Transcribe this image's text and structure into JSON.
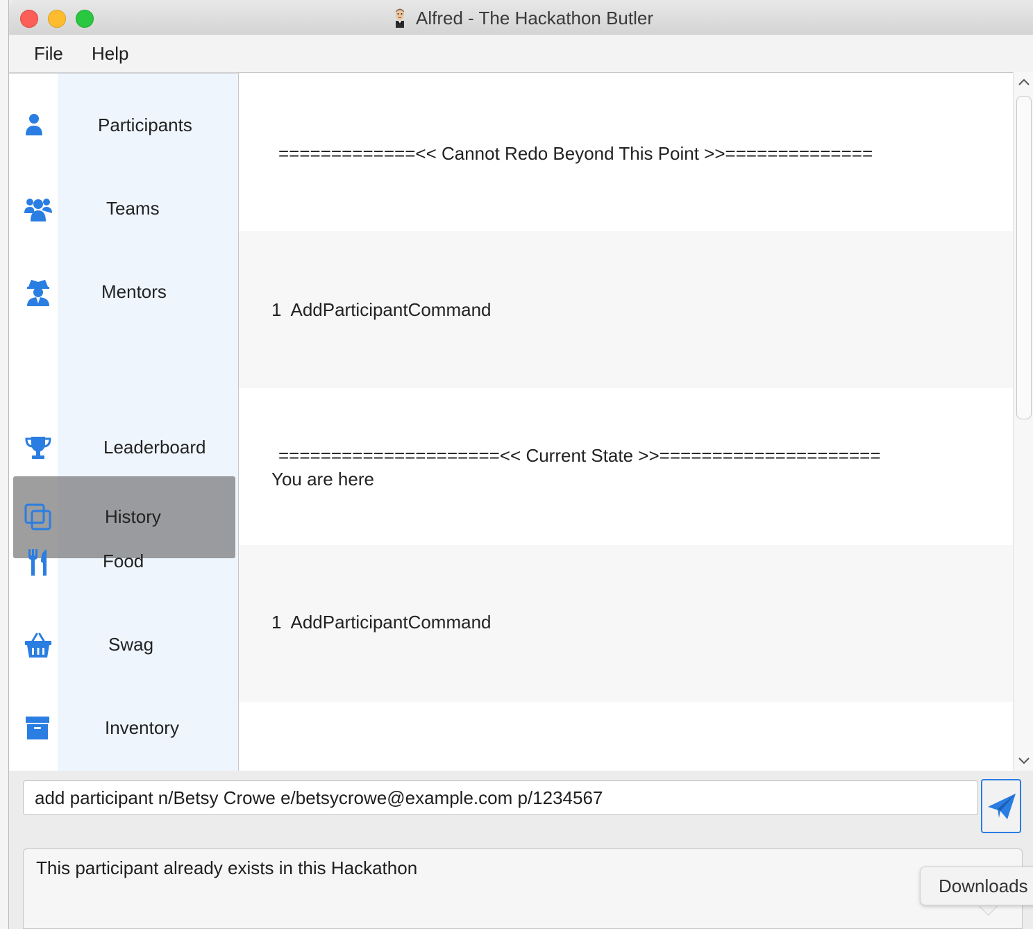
{
  "window": {
    "title": "Alfred - The Hackathon Butler"
  },
  "menu": {
    "file": "File",
    "help": "Help"
  },
  "sidebar": {
    "items": [
      {
        "label": "Participants",
        "icon": "user-icon"
      },
      {
        "label": "Teams",
        "icon": "users-icon"
      },
      {
        "label": "Mentors",
        "icon": "user-secret-icon"
      },
      {
        "label": "Leaderboard",
        "icon": "trophy-icon"
      },
      {
        "label": "History",
        "icon": "copy-icon",
        "selected": true
      },
      {
        "label": "Food",
        "icon": "utensils-icon"
      },
      {
        "label": "Swag",
        "icon": "shopping-basket-icon"
      },
      {
        "label": "Inventory",
        "icon": "archive-icon"
      }
    ]
  },
  "history": {
    "entries": [
      {
        "line1": "=============<< Cannot Redo Beyond This Point >>=============="
      },
      {
        "line1": "1  AddParticipantCommand"
      },
      {
        "line1": "=====================<< Current State >>=====================",
        "line2": "You are here"
      },
      {
        "line1": "1  AddParticipantCommand"
      }
    ]
  },
  "command": {
    "value": "add participant n/Betsy Crowe e/betsycrowe@example.com p/1234567"
  },
  "result": {
    "text": "This participant already exists in this Hackathon"
  },
  "tooltip": {
    "downloads": "Downloads"
  },
  "colors": {
    "accent": "#2a7de1",
    "sidebar_strip": "#eef5fd",
    "selected_overlay": "#787878",
    "close": "#fc5f57",
    "minimize": "#fdbc2e",
    "maximize": "#29c840"
  }
}
